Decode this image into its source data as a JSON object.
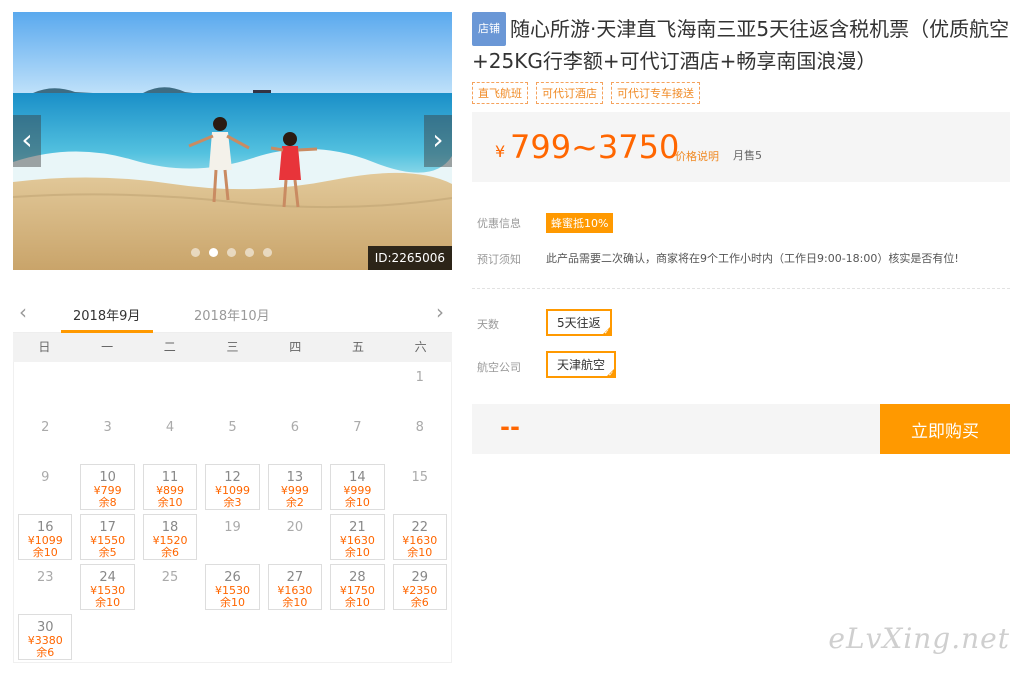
{
  "gallery": {
    "id_label": "ID:2265006",
    "dots": 5,
    "active_dot": 1,
    "prev_glyph": "‹",
    "next_glyph": "›"
  },
  "calendar": {
    "prev_glyph": "‹",
    "next_glyph": "›",
    "months": [
      "2018年9月",
      "2018年10月"
    ],
    "active_month": 0,
    "weekdays": [
      "日",
      "一",
      "二",
      "三",
      "四",
      "五",
      "六"
    ],
    "cells": [
      {
        "d": ""
      },
      {
        "d": ""
      },
      {
        "d": ""
      },
      {
        "d": ""
      },
      {
        "d": ""
      },
      {
        "d": ""
      },
      {
        "d": "1"
      },
      {
        "d": "2"
      },
      {
        "d": "3"
      },
      {
        "d": "4"
      },
      {
        "d": "5"
      },
      {
        "d": "6"
      },
      {
        "d": "7"
      },
      {
        "d": "8"
      },
      {
        "d": "9"
      },
      {
        "d": "10",
        "p": "¥799",
        "r": "余8"
      },
      {
        "d": "11",
        "p": "¥899",
        "r": "余10"
      },
      {
        "d": "12",
        "p": "¥1099",
        "r": "余3"
      },
      {
        "d": "13",
        "p": "¥999",
        "r": "余2"
      },
      {
        "d": "14",
        "p": "¥999",
        "r": "余10"
      },
      {
        "d": "15"
      },
      {
        "d": "16",
        "p": "¥1099",
        "r": "余10"
      },
      {
        "d": "17",
        "p": "¥1550",
        "r": "余5"
      },
      {
        "d": "18",
        "p": "¥1520",
        "r": "余6"
      },
      {
        "d": "19"
      },
      {
        "d": "20"
      },
      {
        "d": "21",
        "p": "¥1630",
        "r": "余10"
      },
      {
        "d": "22",
        "p": "¥1630",
        "r": "余10"
      },
      {
        "d": "23"
      },
      {
        "d": "24",
        "p": "¥1530",
        "r": "余10"
      },
      {
        "d": "25"
      },
      {
        "d": "26",
        "p": "¥1530",
        "r": "余10"
      },
      {
        "d": "27",
        "p": "¥1630",
        "r": "余10"
      },
      {
        "d": "28",
        "p": "¥1750",
        "r": "余10"
      },
      {
        "d": "29",
        "p": "¥2350",
        "r": "余6"
      },
      {
        "d": "30",
        "p": "¥3380",
        "r": "余6"
      }
    ]
  },
  "product": {
    "shop_badge": "店铺",
    "title": "随心所游·天津直飞海南三亚5天往返含税机票（优质航空+25KG行李额+可代订酒店+畅享南国浪漫）",
    "tags": [
      "直飞航班",
      "可代订酒店",
      "可代订专车接送"
    ],
    "currency": "¥",
    "price_range": "799~3750",
    "price_explain": "价格说明",
    "monthly_sales": "月售5"
  },
  "info": {
    "promo_label": "优惠信息",
    "promo_badge": "蜂蜜抵10%",
    "notice_label": "预订须知",
    "notice_text": "此产品需要二次确认，商家将在9个工作小时内（工作日9:00-18:00）核实是否有位!"
  },
  "options": {
    "days_label": "天数",
    "days_value": "5天往返",
    "airline_label": "航空公司",
    "airline_value": "天津航空",
    "check_glyph": "✓"
  },
  "purchase": {
    "total": "--",
    "buy_label": "立即购买"
  },
  "watermark": "eLvXing.net",
  "colors": {
    "accent": "#ff9900",
    "price": "#ff6600",
    "badge": "#6a97d6"
  }
}
